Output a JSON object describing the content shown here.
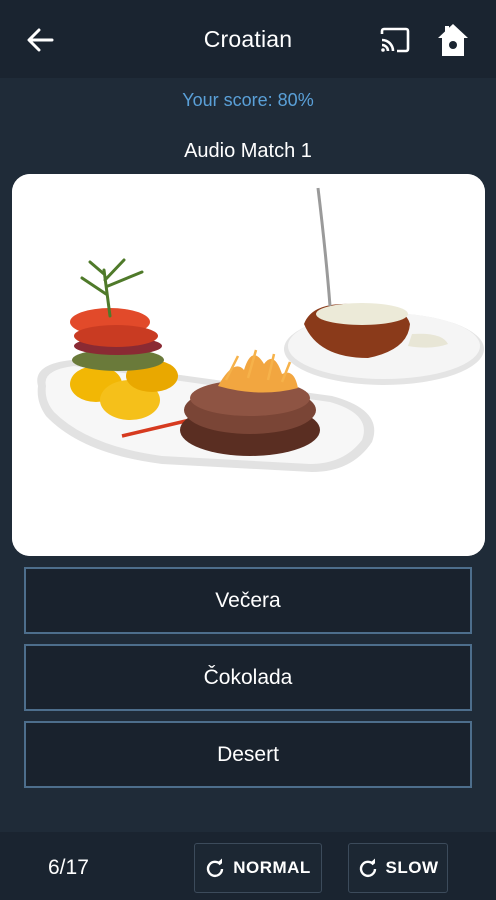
{
  "header": {
    "title": "Croatian",
    "back_icon": "arrow-back-icon",
    "cast_icon": "cast-icon",
    "home_icon": "home-icon"
  },
  "score_text": "Your score: 80%",
  "quiz": {
    "title": "Audio Match 1",
    "image_subject": "plated steak with grilled vegetables and baked potato",
    "options": [
      "Večera",
      "Čokolada",
      "Desert"
    ]
  },
  "footer": {
    "progress": "6/17",
    "normal_label": "NORMAL",
    "slow_label": "SLOW",
    "replay_icon": "replay-icon"
  },
  "colors": {
    "background": "#1f2b38",
    "bar": "#1a2430",
    "score": "#5aa0d8",
    "option_border": "#4d6e8c"
  }
}
